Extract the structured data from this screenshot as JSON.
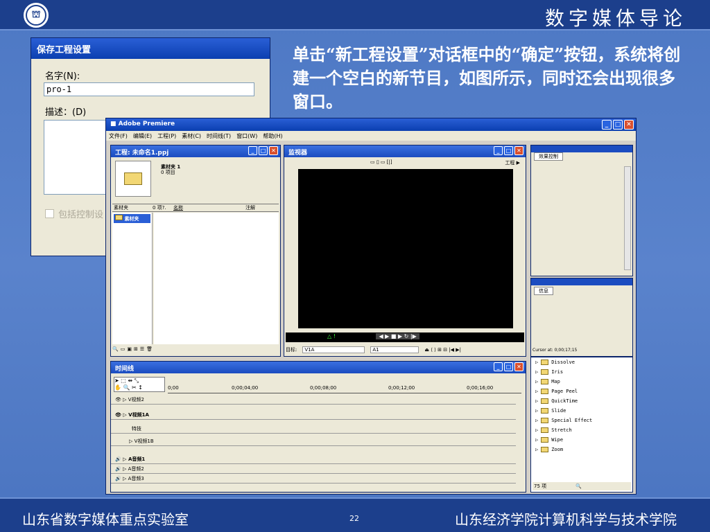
{
  "slide": {
    "course_title": "数字媒体导论",
    "caption": "单击“新工程设置”对话框中的“确定”按钮，系统将创建一个空白的新节目，如图所示，同时还会出现很多窗口。",
    "footer_left": "山东省数字媒体重点实验室",
    "page_number": "22",
    "footer_right": "山东经济学院计算机科学与技术学院"
  },
  "dialog": {
    "title": "保存工程设置",
    "name_label": "名字(N):",
    "name_value": "pro-1",
    "desc_label": "描述：(D)",
    "checkbox_label": "包括控制设"
  },
  "app": {
    "title": "Adobe Premiere",
    "menu": [
      "文件(F)",
      "编辑(E)",
      "工程(P)",
      "素材(C)",
      "时间线(T)",
      "窗口(W)",
      "帮助(H)"
    ]
  },
  "project_panel": {
    "title": "工程: 未命名1.ppj",
    "bin_name": "素材夹 1",
    "bin_count": "0 项目",
    "col_bin": "素材夹",
    "col_items": "0 项?.",
    "col_name": "名称",
    "col_note": "注解",
    "tree_item": "素材夹"
  },
  "monitor_panel": {
    "title": "监视器",
    "mode_label": "工程",
    "target_label": "目标:",
    "target_video": "V1A",
    "target_audio": "A1"
  },
  "effects_panel": {
    "tab": "效果控制"
  },
  "info_panel": {
    "tab": "信息",
    "cursor": "Cursor at: 0;00;17;15"
  },
  "transitions_panel": {
    "items": [
      "Dissolve",
      "Iris",
      "Map",
      "Page Peel",
      "QuickTime",
      "Slide",
      "Special Effect",
      "Stretch",
      "Wipe",
      "Zoom"
    ],
    "count": "75 项"
  },
  "timeline_panel": {
    "title": "时间线",
    "timecodes": [
      "0;00",
      "0;00;04;00",
      "0;00;08;00",
      "0;00;12;00",
      "0;00;16;00"
    ],
    "tracks": {
      "v2": "V视频2",
      "v1a": "V视频1A",
      "trans": "特技",
      "v1b": "V视频1B",
      "a1": "A音频1",
      "a2": "A音频2",
      "a3": "A音频3"
    }
  }
}
